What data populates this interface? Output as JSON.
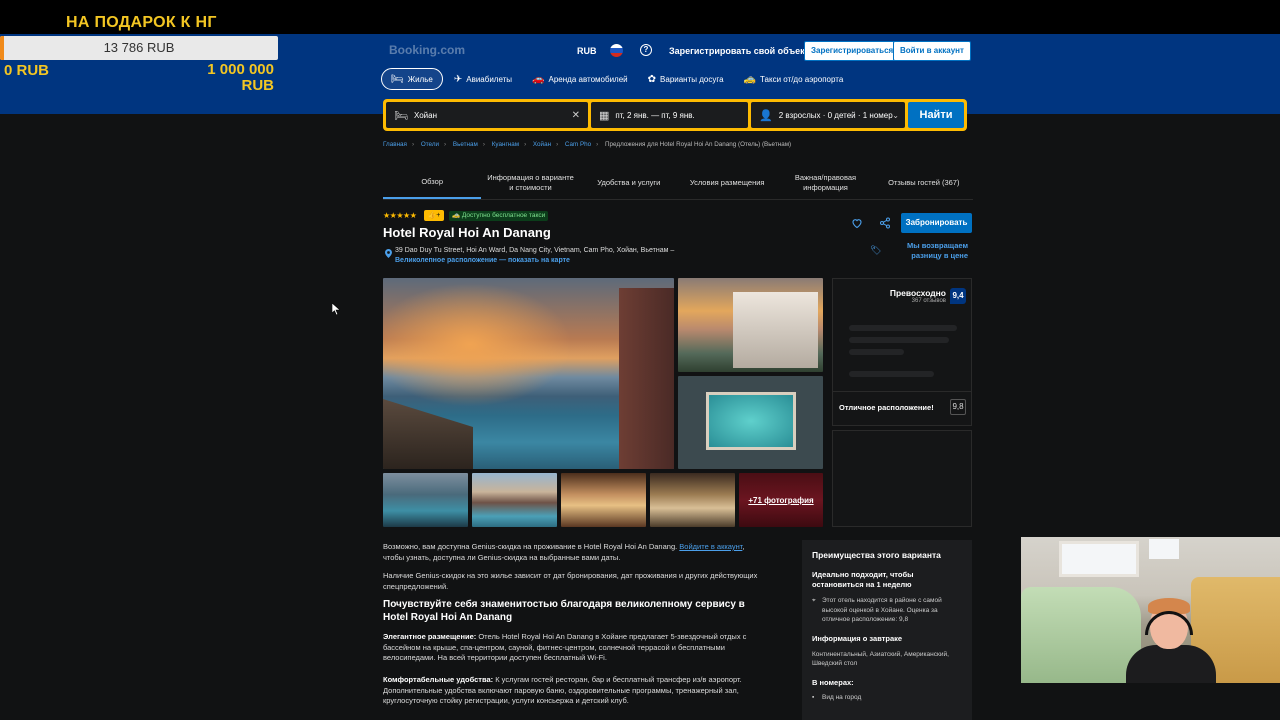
{
  "overlay": {
    "promo_title": "НА ПОДАРОК К НГ",
    "progress_value": "13 786 RUB",
    "progress_fraction": 0.013786,
    "min_label": "0 RUB",
    "max_label": "1 000 000 RUB",
    "accent_color": "#f3c623",
    "fill_color": "#f08a1a"
  },
  "header": {
    "logo": "Booking.com",
    "currency": "RUB",
    "list_property": "Зарегистрировать свой объект",
    "register": "Зарегистрироваться",
    "sign_in": "Войти в аккаунт",
    "brand_color": "#003580"
  },
  "nav": [
    {
      "icon": "bed-icon",
      "label": "Жилье",
      "active": true
    },
    {
      "icon": "plane-icon",
      "label": "Авиабилеты"
    },
    {
      "icon": "car-icon",
      "label": "Аренда автомобилей"
    },
    {
      "icon": "attractions-icon",
      "label": "Варианты досуга"
    },
    {
      "icon": "taxi-icon",
      "label": "Такси от/до аэропорта"
    }
  ],
  "search": {
    "destination": "Хойан",
    "dates": "пт, 2 янв. — пт, 9 янв.",
    "guests": "2 взрослых · 0 детей · 1 номер",
    "submit": "Найти"
  },
  "breadcrumbs": [
    "Главная",
    "Отели",
    "Вьетнам",
    "Куангнам",
    "Хойан",
    "Cam Pho"
  ],
  "breadcrumb_current": "Предложения для Hotel Royal Hoi An Danang (Отель) (Вьетнам)",
  "tabs": [
    "Обзор",
    "Информация о варианте и стоимости",
    "Удобства и услуги",
    "Условия размещения",
    "Важная/правовая информация",
    "Отзывы гостей (367)"
  ],
  "hotel": {
    "stars": "★★★★★",
    "taxi_badge": "Доступно бесплатное такси",
    "name": "Hotel Royal Hoi An Danang",
    "address": "39 Dao Duy Tu Street, Hoi An Ward, Da Nang City, Vietnam, Cam Pho, Хойан, Вьетнам –",
    "location_link": "Великолепное расположение — показать на карте",
    "reserve": "Забронировать",
    "price_match": "Мы возвращаем разницу в цене",
    "more_photos": "+71 фотография"
  },
  "rating": {
    "label": "Превосходно",
    "reviews": "367 отзывов",
    "score": "9,4",
    "location_label": "Отличное расположение!",
    "location_score": "9,8"
  },
  "description": {
    "genius_1": "Возможно, вам доступна Genius-скидка на проживание в Hotel Royal Hoi An Danang.",
    "genius_link": "Войдите в аккаунт",
    "genius_2": ", чтобы узнать, доступна ли Genius-скидка на выбранные вами даты.",
    "genius_note": "Наличие Genius-скидок на это жилье зависит от дат бронирования, дат проживания и других действующих спецпредложений.",
    "heading": "Почувствуйте себя знаменитостью благодаря великолепному сервису в Hotel Royal Hoi An Danang",
    "p1_title": "Элегантное размещение:",
    "p1_text": " Отель Hotel Royal Hoi An Danang в Хойане предлагает 5-звездочный отдых с бассейном на крыше, спа-центром, сауной, фитнес-центром, солнечной террасой и бесплатными велосипедами. На всей территории доступен бесплатный Wi-Fi.",
    "p2_title": "Комфортабельные удобства:",
    "p2_text": " К услугам гостей ресторан, бар и бесплатный трансфер из/в аэропорт. Дополнительные удобства включают паровую баню, оздоровительные программы, тренажерный зал, круглосуточную стойку регистрации, услуги консьержа и детский клуб."
  },
  "advantages": {
    "title": "Преимущества этого варианта",
    "subtitle": "Идеально подходит, чтобы остановиться на 1 неделю",
    "location_text": "Этот отель находится в районе с самой высокой оценкой в Хойане. Оценка за отличное расположение: 9,8",
    "breakfast_title": "Информация о завтраке",
    "breakfast_text": "Континентальный, Азиатский, Американский, Шведский стол",
    "rooms_title": "В номерах:",
    "room_item_1": "Вид на город"
  }
}
